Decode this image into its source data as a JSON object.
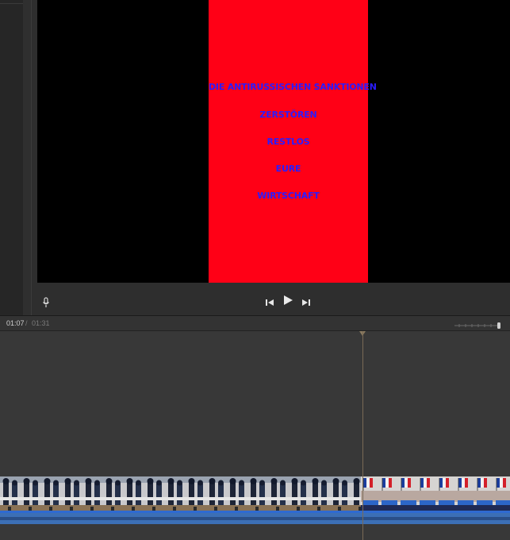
{
  "video": {
    "lines": [
      "DIE ANTIRUSSISCHEN SANKTIONEN",
      "ZERSTÖREN",
      "RESTLOS",
      "EURE",
      "WIRTSCHAFT"
    ],
    "background_color": "#ff0016",
    "text_color": "#2a1cff"
  },
  "playback": {
    "current_time": "01:07",
    "separator": "/",
    "total_time": "01:31"
  },
  "icons": {
    "mic": "microphone-icon",
    "prev": "skip-back-icon",
    "play": "play-icon",
    "next": "skip-forward-icon",
    "zoom": "zoom-slider-icon"
  }
}
